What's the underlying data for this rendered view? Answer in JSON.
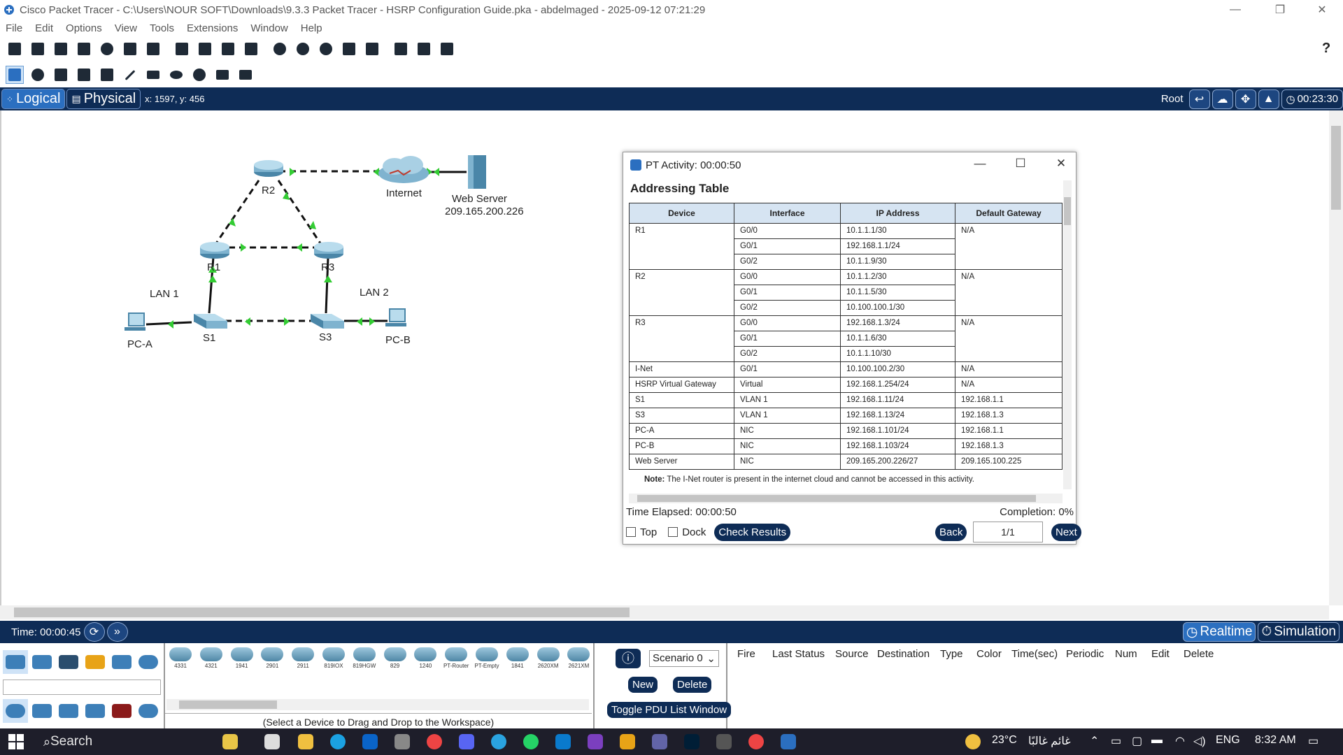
{
  "window": {
    "title": "Cisco Packet Tracer - C:\\Users\\NOUR SOFT\\Downloads\\9.3.3 Packet Tracer - HSRP Configuration Guide.pka - abdelmaged - 2025-09-12 07:21:29"
  },
  "menu": [
    "File",
    "Edit",
    "Options",
    "View",
    "Tools",
    "Extensions",
    "Window",
    "Help"
  ],
  "tabs": {
    "logical": "Logical",
    "physical": "Physical",
    "coords": "x: 1597, y: 456",
    "root": "Root",
    "clock": "00:23:30"
  },
  "topology": {
    "devices": {
      "r1": "R1",
      "r2": "R2",
      "r3": "R3",
      "s1": "S1",
      "s3": "S3",
      "pca": "PC-A",
      "pcb": "PC-B",
      "internet": "Internet",
      "server": "Web Server",
      "server_ip": "209.165.200.226",
      "lan1": "LAN 1",
      "lan2": "LAN 2"
    }
  },
  "activity": {
    "title": "PT Activity: 00:00:50",
    "heading": "Addressing Table",
    "columns": [
      "Device",
      "Interface",
      "IP Address",
      "Default Gateway"
    ],
    "rows": [
      {
        "device": "R1",
        "iface": "G0/0",
        "ip": "10.1.1.1/30",
        "gw": "N/A"
      },
      {
        "device": "",
        "iface": "G0/1",
        "ip": "192.168.1.1/24",
        "gw": ""
      },
      {
        "device": "",
        "iface": "G0/2",
        "ip": "10.1.1.9/30",
        "gw": ""
      },
      {
        "device": "R2",
        "iface": "G0/0",
        "ip": "10.1.1.2/30",
        "gw": "N/A"
      },
      {
        "device": "",
        "iface": "G0/1",
        "ip": "10.1.1.5/30",
        "gw": ""
      },
      {
        "device": "",
        "iface": "G0/2",
        "ip": "10.100.100.1/30",
        "gw": ""
      },
      {
        "device": "R3",
        "iface": "G0/0",
        "ip": "192.168.1.3/24",
        "gw": "N/A"
      },
      {
        "device": "",
        "iface": "G0/1",
        "ip": "10.1.1.6/30",
        "gw": ""
      },
      {
        "device": "",
        "iface": "G0/2",
        "ip": "10.1.1.10/30",
        "gw": ""
      },
      {
        "device": "I-Net",
        "iface": "G0/1",
        "ip": "10.100.100.2/30",
        "gw": "N/A"
      },
      {
        "device": "HSRP Virtual Gateway",
        "iface": "Virtual",
        "ip": "192.168.1.254/24",
        "gw": "N/A"
      },
      {
        "device": "S1",
        "iface": "VLAN 1",
        "ip": "192.168.1.11/24",
        "gw": "192.168.1.1"
      },
      {
        "device": "S3",
        "iface": "VLAN 1",
        "ip": "192.168.1.13/24",
        "gw": "192.168.1.3"
      },
      {
        "device": "PC-A",
        "iface": "NIC",
        "ip": "192.168.1.101/24",
        "gw": "192.168.1.1"
      },
      {
        "device": "PC-B",
        "iface": "NIC",
        "ip": "192.168.1.103/24",
        "gw": "192.168.1.3"
      },
      {
        "device": "Web Server",
        "iface": "NIC",
        "ip": "209.165.200.226/27",
        "gw": "209.165.100.225"
      }
    ],
    "note_label": "Note:",
    "note": "The I-Net router is present in the internet cloud and cannot be accessed in this activity.",
    "time_elapsed": "Time Elapsed: 00:00:50",
    "completion": "Completion: 0%",
    "top": "Top",
    "dock": "Dock",
    "check": "Check Results",
    "back": "Back",
    "page": "1/1",
    "next": "Next"
  },
  "bottom": {
    "time": "Time: 00:00:45",
    "realtime": "Realtime",
    "simulation": "Simulation",
    "devices": [
      "4331",
      "4321",
      "1941",
      "2901",
      "2911",
      "819IOX",
      "819HGW",
      "829",
      "1240",
      "PT-Router",
      "PT-Empty",
      "1841",
      "2620XM",
      "2621XM"
    ],
    "hint": "(Select a Device to Drag and Drop to the Workspace)",
    "scenario": "Scenario 0",
    "new": "New",
    "delete": "Delete",
    "toggle": "Toggle PDU List Window",
    "pdu_cols": [
      "Fire",
      "Last Status",
      "Source",
      "Destination",
      "Type",
      "Color",
      "Time(sec)",
      "Periodic",
      "Num",
      "Edit",
      "Delete"
    ]
  },
  "taskbar": {
    "search": "Search",
    "weather": "23°C",
    "weather_text": "غائم غالبًا",
    "lang": "ENG",
    "time": "8:32 AM"
  },
  "colors": {
    "navy": "#0e2c56",
    "accent": "#2b6fc0",
    "link_green": "#33cc33"
  }
}
